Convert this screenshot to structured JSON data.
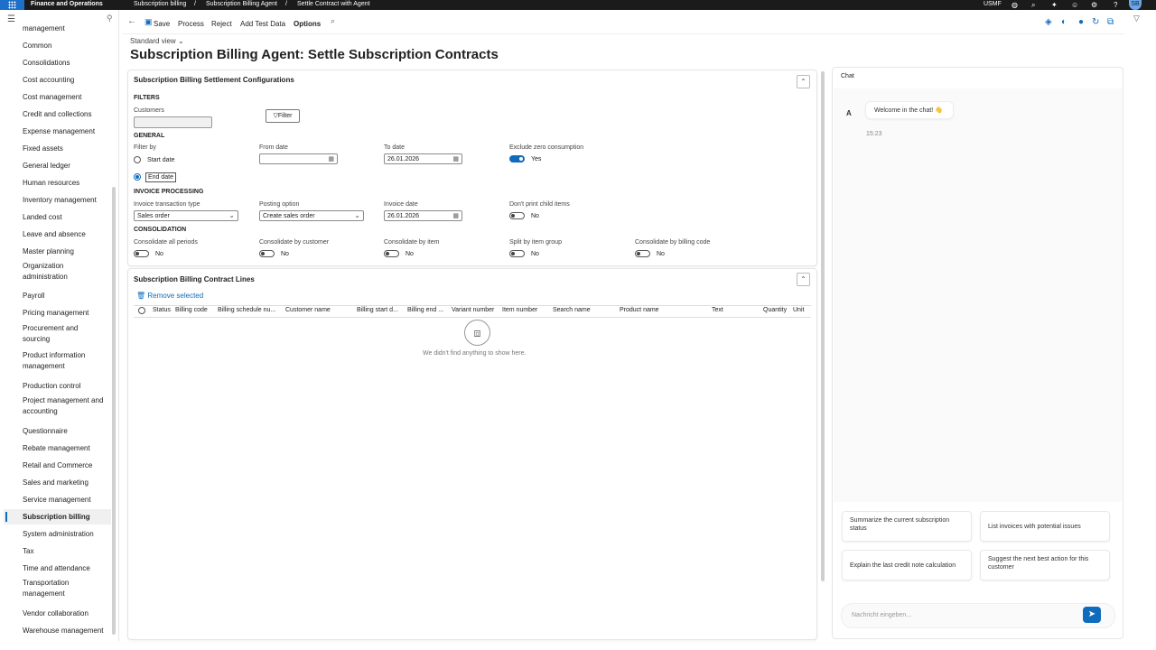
{
  "topbar": {
    "app_name": "Finance and Operations",
    "breadcrumb": [
      "Subscription billing",
      "Subscription Billing Agent",
      "Settle Contract with Agent"
    ],
    "company": "USMF",
    "avatar_initials": "SB"
  },
  "sidebar": {
    "items": [
      "management",
      "Common",
      "Consolidations",
      "Cost accounting",
      "Cost management",
      "Credit and collections",
      "Expense management",
      "Fixed assets",
      "General ledger",
      "Human resources",
      "Inventory management",
      "Landed cost",
      "Leave and absence",
      "Master planning",
      "Organization administration",
      "Payroll",
      "Pricing management",
      "Procurement and sourcing",
      "Product information management",
      "Production control",
      "Project management and accounting",
      "Questionnaire",
      "Rebate management",
      "Retail and Commerce",
      "Sales and marketing",
      "Service management",
      "Subscription billing",
      "System administration",
      "Tax",
      "Time and attendance",
      "Transportation management",
      "Vendor collaboration",
      "Warehouse management"
    ],
    "active": "Subscription billing"
  },
  "actions": {
    "save": "Save",
    "process": "Process",
    "reject": "Reject",
    "add_test_data": "Add Test Data",
    "options": "Options"
  },
  "page": {
    "view": "Standard view",
    "title": "Subscription Billing Agent: Settle Subscription Contracts"
  },
  "config": {
    "title": "Subscription Billing Settlement Configurations",
    "filters_heading": "FILTERS",
    "customers_label": "Customers",
    "customers_value": "",
    "filter_button": "Filter",
    "general_heading": "GENERAL",
    "filter_by_label": "Filter by",
    "filter_by_options": [
      "Start date",
      "End date"
    ],
    "filter_by_selected": "End date",
    "from_date_label": "From date",
    "from_date_value": "",
    "to_date_label": "To date",
    "to_date_value": "26.01.2026",
    "exclude_zero_label": "Exclude zero consumption",
    "exclude_zero_value": "Yes",
    "invoice_heading": "INVOICE PROCESSING",
    "invoice_type_label": "Invoice transaction type",
    "invoice_type_value": "Sales order",
    "posting_option_label": "Posting option",
    "posting_option_value": "Create sales order",
    "invoice_date_label": "Invoice date",
    "invoice_date_value": "26.01.2026",
    "dont_print_label": "Don't print child items",
    "dont_print_value": "No",
    "consolidation_heading": "CONSOLIDATION",
    "consol_all_label": "Consolidate all periods",
    "consol_all_value": "No",
    "consol_customer_label": "Consolidate by customer",
    "consol_customer_value": "No",
    "consol_item_label": "Consolidate by item",
    "consol_item_value": "No",
    "split_group_label": "Split by item group",
    "split_group_value": "No",
    "consol_billing_label": "Consolidate by billing code",
    "consol_billing_value": "No"
  },
  "lines": {
    "title": "Subscription Billing Contract Lines",
    "remove_selected": "Remove selected",
    "columns": [
      "Status",
      "Billing code",
      "Billing schedule nu...",
      "Customer name",
      "Billing start d...",
      "Billing end ...",
      "Variant number",
      "Item number",
      "Search name",
      "Product name",
      "Text",
      "Quantity",
      "Unit"
    ],
    "empty_message": "We didn't find anything to show here."
  },
  "chat": {
    "title": "Chat",
    "agent_initial": "A",
    "welcome": "Welcome in the chat! 👋",
    "time": "15:23",
    "suggestions": [
      "Summarize the current subscription status",
      "List invoices with potential issues",
      "Explain the last credit note calculation",
      "Suggest the next best action for this customer"
    ],
    "input_placeholder": "Nachricht eingeben..."
  }
}
